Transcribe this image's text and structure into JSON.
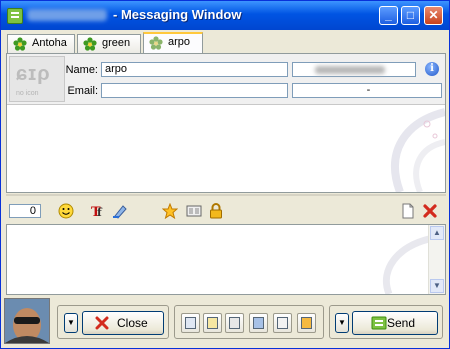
{
  "window": {
    "title": "- Messaging Window"
  },
  "tabs": [
    {
      "label": "Antoha"
    },
    {
      "label": "green"
    },
    {
      "label": "arpo"
    }
  ],
  "contact": {
    "name_label": "Name:",
    "name_value": "arpo",
    "email_label": "Email:",
    "email_value": "",
    "right_value": "-",
    "avatar_text": "no icon"
  },
  "toolbar": {
    "counter": "0"
  },
  "buttons": {
    "close_label": "Close",
    "send_label": "Send"
  },
  "colors": {
    "title_bar": "#0054e3",
    "close_red": "#d32b1e",
    "accent_green": "#3c8d0d"
  }
}
